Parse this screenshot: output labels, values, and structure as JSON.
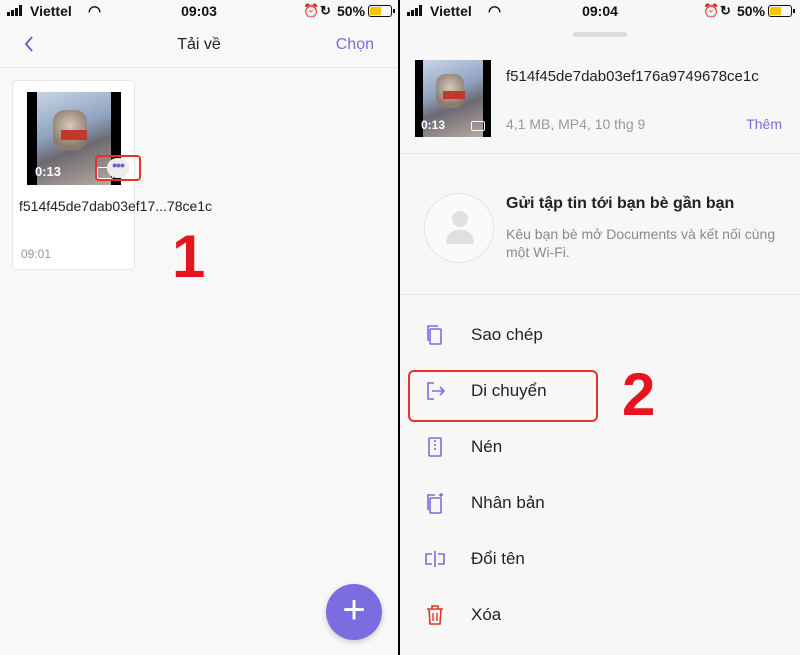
{
  "left": {
    "status": {
      "carrier": "Viettel",
      "time": "09:03",
      "battery": "50%"
    },
    "nav": {
      "back_icon": "chevron-left-icon",
      "title": "Tải về",
      "action": "Chọn"
    },
    "file": {
      "duration": "0:13",
      "name": "f514f45de7dab03ef17...78ce1c",
      "time": "09:01"
    },
    "step_label": "1"
  },
  "right": {
    "status": {
      "carrier": "Viettel",
      "time": "09:04",
      "battery": "50%"
    },
    "file": {
      "duration": "0:13",
      "name": "f514f45de7dab03ef176a9749678ce1c",
      "meta": "4,1 MB, MP4, 10 thg 9",
      "more": "Thêm"
    },
    "nearby": {
      "title": "Gửi tập tin tới bạn bè gần bạn",
      "desc": "Kêu bạn bè mở Documents và kết nối cùng một Wi-Fi."
    },
    "menu": [
      {
        "label": "Sao chép",
        "icon": "copy-icon"
      },
      {
        "label": "Di chuyển",
        "icon": "move-icon"
      },
      {
        "label": "Nén",
        "icon": "zip-icon"
      },
      {
        "label": "Nhân bản",
        "icon": "duplicate-icon"
      },
      {
        "label": "Đổi tên",
        "icon": "rename-icon"
      },
      {
        "label": "Xóa",
        "icon": "trash-icon"
      }
    ],
    "step_label": "2"
  },
  "colors": {
    "accent": "#7b6ce0",
    "highlight": "#e5332a",
    "step": "#e5151d",
    "delete": "#e5332a"
  }
}
